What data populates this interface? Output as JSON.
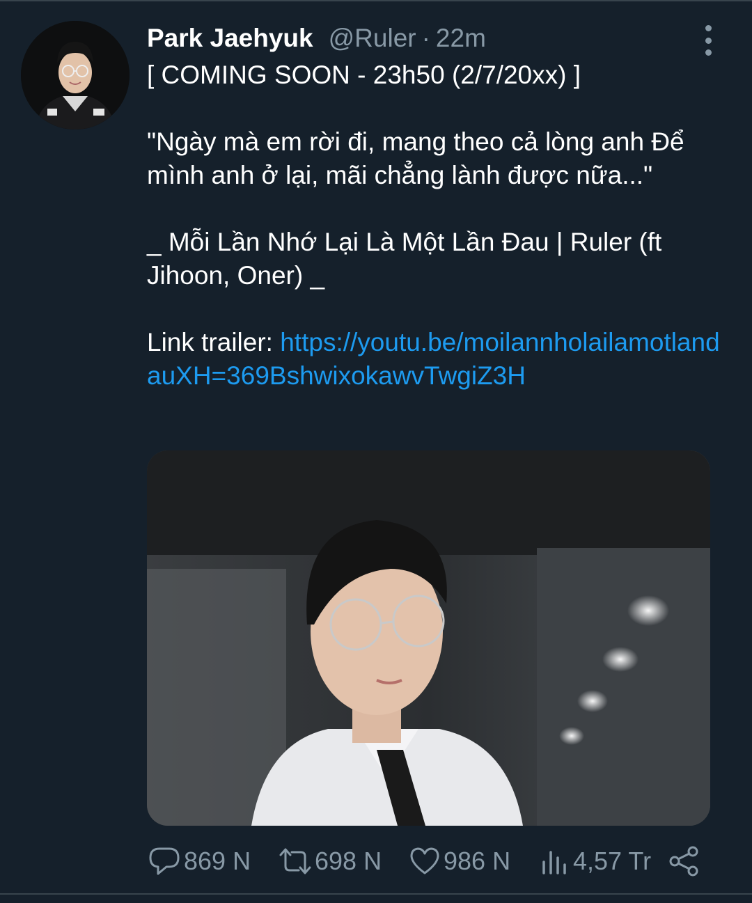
{
  "tweet": {
    "author_name": "Park Jaehyuk",
    "handle": "@Ruler",
    "separator": "·",
    "time_ago": "22m",
    "lines": {
      "announcement": "[ COMING SOON - 23h50 (2/7/20xx) ]",
      "quote": "\"Ngày mà em rời đi, mang theo cả lòng anh Để mình anh ở lại, mãi chẳng lành được nữa...\"",
      "song_title": "_ Mỗi Lần Nhớ Lại Là Một Lần Đau | Ruler (ft Jihoon, Oner) _",
      "link_label": "Link trailer: ",
      "link_url": "https://youtu.be/moilannholailamotlandauXH=369BshwixokawvTwgiZ3H"
    }
  },
  "actions": {
    "replies": "869 N",
    "retweets": "698 N",
    "likes": "986 N",
    "views": "4,57 Tr"
  },
  "icons": {
    "reply": "speech-bubble-icon",
    "retweet": "retweet-icon",
    "like": "heart-icon",
    "views": "bar-chart-icon",
    "share": "share-icon",
    "more": "vertical-ellipsis-icon"
  },
  "colors": {
    "background": "#15202b",
    "text": "#ffffff",
    "muted": "#8899a6",
    "link": "#1d9bf0",
    "divider": "#38444d"
  }
}
